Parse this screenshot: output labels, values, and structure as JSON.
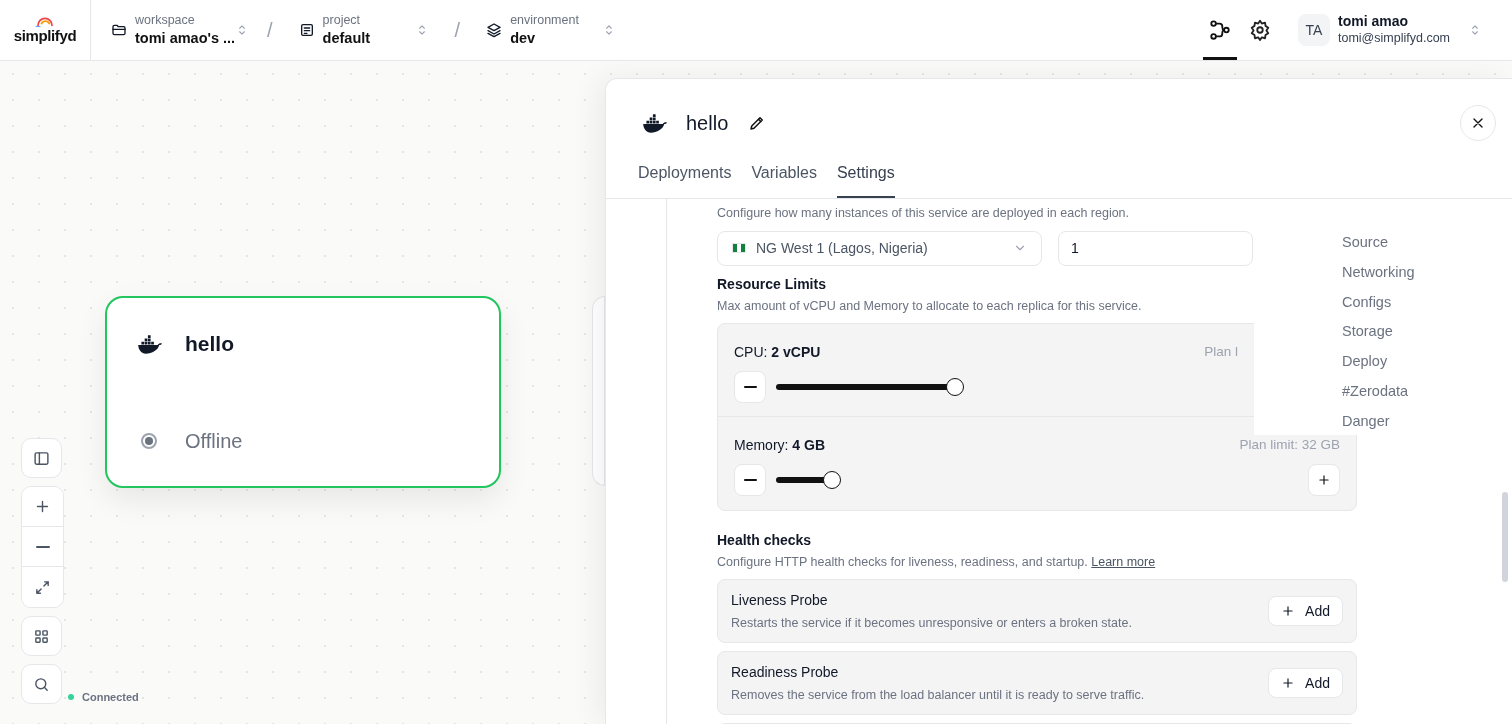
{
  "header": {
    "logo": "simplifyd",
    "breadcrumbs": [
      {
        "kind": "workspace",
        "label": "workspace",
        "value": "tomi amao's ..."
      },
      {
        "kind": "project",
        "separator": "/",
        "label": "project",
        "value": "default"
      },
      {
        "kind": "environment",
        "separator": "/",
        "label": "environment",
        "value": "dev"
      }
    ],
    "nav_icons": [
      {
        "kind": "graph",
        "selected": true
      },
      {
        "kind": "settings",
        "selected": false
      }
    ],
    "user": {
      "initials": "TA",
      "name": "tomi amao",
      "email": "tomi@simplifyd.com"
    }
  },
  "canvas": {
    "node": {
      "title": "hello",
      "status": "Offline"
    },
    "status": "Connected"
  },
  "panel": {
    "title": "hello",
    "tabs": [
      {
        "label": "Deployments",
        "selected": false
      },
      {
        "label": "Variables",
        "selected": false
      },
      {
        "label": "Settings",
        "selected": true
      }
    ],
    "regions": {
      "description": "Configure how many instances of this service are deployed in each region.",
      "region": "NG West 1 (Lagos, Nigeria)",
      "replicas": "1"
    },
    "resource_limits": {
      "title": "Resource Limits",
      "description": "Max amount of vCPU and Memory to allocate to each replica for this service.",
      "sliders": [
        {
          "label": "CPU: ",
          "value": "2 vCPU",
          "limit": "Plan l",
          "level": 0.38,
          "plus_visible": false
        },
        {
          "label": "Memory: ",
          "value": "4 GB",
          "limit": "Plan limit: 32 GB",
          "level": 0.12,
          "plus_visible": true
        }
      ]
    },
    "health_checks": {
      "title": "Health checks",
      "description": "Configure HTTP health checks for liveness, readiness, and startup.",
      "link": "Learn more",
      "probes": [
        {
          "title": "Liveness Probe",
          "description": "Restarts the service if it becomes unresponsive or enters a broken state.",
          "button": "Add"
        },
        {
          "title": "Readiness Probe",
          "description": "Removes the service from the load balancer until it is ready to serve traffic.",
          "button": "Add"
        }
      ]
    },
    "section_nav": [
      "Source",
      "Networking",
      "Configs",
      "Storage",
      "Deploy",
      "#Zerodata",
      "Danger"
    ]
  }
}
